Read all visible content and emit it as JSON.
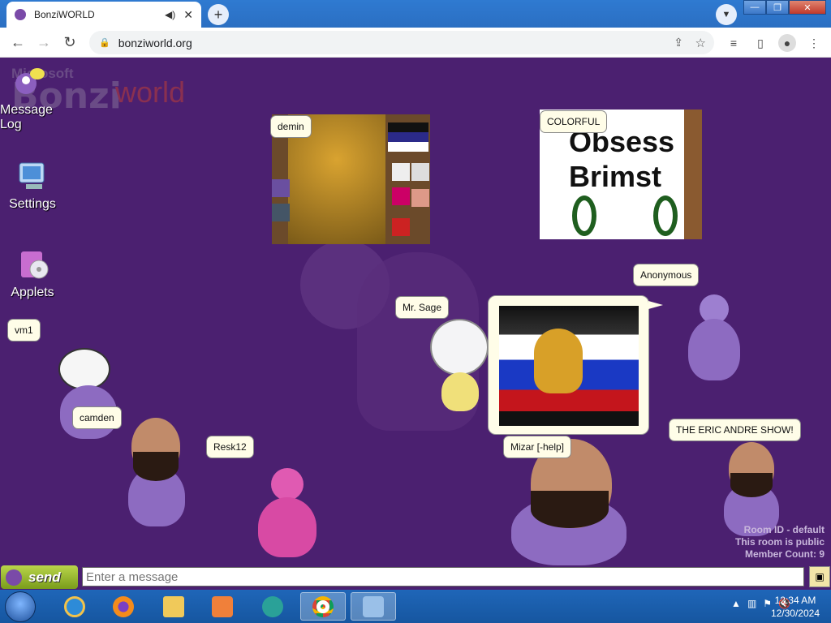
{
  "browser": {
    "tab_title": "BonziWORLD",
    "address": "bonziworld.org"
  },
  "site": {
    "logo_prefix": "Microsoft",
    "logo_bonzi": "Bonzi",
    "logo_world": "world"
  },
  "desktop_icons": [
    {
      "label": "Message Log",
      "icon": "message-log-icon"
    },
    {
      "label": "Settings",
      "icon": "settings-icon"
    },
    {
      "label": "Applets",
      "icon": "applets-icon"
    }
  ],
  "users": {
    "demin": "demin",
    "colorful": "COLORFUL",
    "anonymous": "Anonymous",
    "mr_sage": "Mr. Sage",
    "vm1": "vm1",
    "camden": "camden",
    "resk12": "Resk12",
    "mizar": "Mizar [-help]",
    "eric": "THE ERIC ANDRE SHOW!"
  },
  "colorful_sign": {
    "line1": "Obsess",
    "line2": "Brimst"
  },
  "room": {
    "id_text": "Room ID - default",
    "public_text": "This room is public",
    "member_text": "Member Count: 9"
  },
  "chat": {
    "send_label": "send",
    "input_placeholder": "Enter a message"
  },
  "taskbar": {
    "time": "12:34 AM",
    "date": "12/30/2024"
  },
  "colors": {
    "page_bg": "#4b2070",
    "bonzi_purple": "#8d6bc1",
    "send_green": "#9cbb2f"
  }
}
